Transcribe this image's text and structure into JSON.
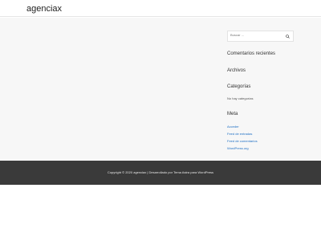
{
  "header": {
    "site_title": "agenciax"
  },
  "sidebar": {
    "search": {
      "placeholder": "Buscar …"
    },
    "recent_comments_title": "Comentarios recientes",
    "archives_title": "Archivos",
    "categories_title": "Categorías",
    "no_categories": "No hay categorías",
    "meta_title": "Meta",
    "meta_links": [
      "Acceder",
      "Feed de entradas",
      "Feed de comentarios",
      "WordPress.org"
    ]
  },
  "footer": {
    "copyright": "Copyright © 2020 agenciax | Desarrollado por Tema Astra para WordPress"
  },
  "colors": {
    "footer_bg": "#3a3a3a",
    "link": "#1e6fc4",
    "content_bg": "#f7f7f7"
  },
  "icons": {
    "search": "search-icon"
  }
}
